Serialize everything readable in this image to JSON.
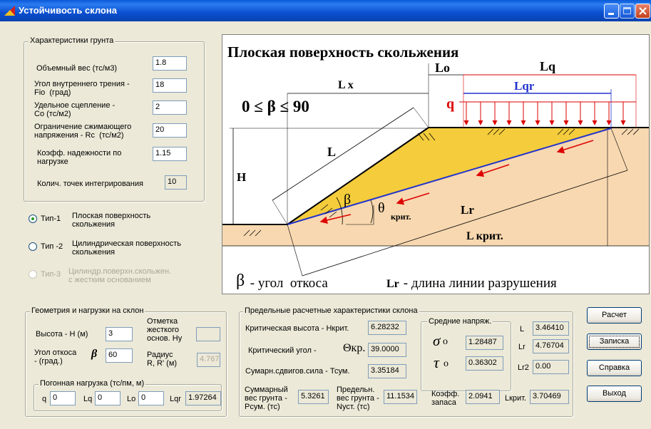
{
  "window": {
    "title": "Устойчивость склона"
  },
  "soil": {
    "legend": "Характеристики грунта",
    "fields": [
      {
        "label": "Объемный вес  (тс/м3)",
        "value": "1.8"
      },
      {
        "label": "Угол внутреннего трения -\nFio  (град)",
        "value": "18"
      },
      {
        "label": "Удельное сцепление -\nCo (тс/м2)",
        "value": "2"
      },
      {
        "label": "Ограничение сжимающего\nнапряжения - Rc  (тс/м2)",
        "value": "20"
      },
      {
        "label": "Коэфф. надежности по\nнагрузке",
        "value": "1.15"
      }
    ],
    "points_label": "Колич. точек интегрирования",
    "points_value": "10"
  },
  "types": [
    {
      "radio": "Тип-1",
      "label": "Плоская поверхность\nскольжения",
      "selected": true,
      "enabled": true
    },
    {
      "radio": "Тип -2",
      "label": "Цилиндрическая поверхность\nскольжения",
      "selected": false,
      "enabled": true
    },
    {
      "radio": "Тип-3",
      "label": "Цилиндр.поверхн.скольжен.\nс жестким основанием",
      "selected": false,
      "enabled": false
    }
  ],
  "diagram": {
    "title": "Плоская поверхность скольжения",
    "formula": "0 ≤ β ≤ 90",
    "labels": {
      "lo": "Lo",
      "lq": "Lq",
      "lqr": "Lqr",
      "q": "q",
      "lx": "L x",
      "l": "L",
      "h": "H",
      "beta": "β",
      "theta": "θ",
      "theta_sub": "крит.",
      "lr": "Lr",
      "lcrit": "L крит."
    },
    "footer_beta_sym": "β",
    "footer_beta_text": " - угол  откоса",
    "footer_lr_sym": "Lr",
    "footer_lr_text": " - длина линии разрушения"
  },
  "geometry": {
    "legend": "Геометрия и нагрузки на склон",
    "height_label": "Высота - H (м)",
    "height_value": "3",
    "mark_label": "Отметка\nжесткого\nоснов. Hy",
    "mark_value": "",
    "angle_label": "Угол откоса\n- (град.)",
    "angle_symbol": "β",
    "angle_value": "60",
    "radius_label": "Радиус\nR, R' (м)",
    "radius_value": "4.767",
    "load_legend": "Погонная нагрузка (тс/пм,  м)",
    "q_label": "q",
    "q_value": "0",
    "lq_label": "Lq",
    "lq_value": "0",
    "lo_label": "Lo",
    "lo_value": "0",
    "lqr_label": "Lqr",
    "lqr_value": "1.97264"
  },
  "results": {
    "legend": "Предельные расчетные характеристики склона",
    "hcrit_label": "Критическая высота - Нкрит.",
    "hcrit_value": "6.28232",
    "angle_label": "Критический угол -",
    "angle_symbol": "Θкр.",
    "angle_value": "39.0000",
    "shear_label": "Сумарн.сдвигов.сила - Тсум.",
    "shear_value": "3.35184",
    "stress_legend": "Средние напряж.",
    "sigma_symbol": "σ",
    "sigma_value": "1.28487",
    "tau_symbol": "τ",
    "tau_value": "0.36302",
    "l_label": "L",
    "l_value": "3.46410",
    "lr_label": "Lr",
    "lr_value": "4.76704",
    "lr2_label": "Lr2",
    "lr2_value": "0.00",
    "psum_label": "Суммарный\nвес грунта -\nPсум. (тс)",
    "psum_value": "5.3261",
    "pust_label": "Предельн.\nвес грунта -\nNуст. (тс)",
    "pust_value": "11.1534",
    "ks_label": "Коэфф.\nзапаса",
    "ks_value": "2.0941",
    "lcrit_label": "Lкрит.",
    "lcrit_value": "3.70469"
  },
  "buttons": {
    "calc": "Расчет",
    "note": "Записка",
    "help": "Справка",
    "exit": "Выход"
  }
}
